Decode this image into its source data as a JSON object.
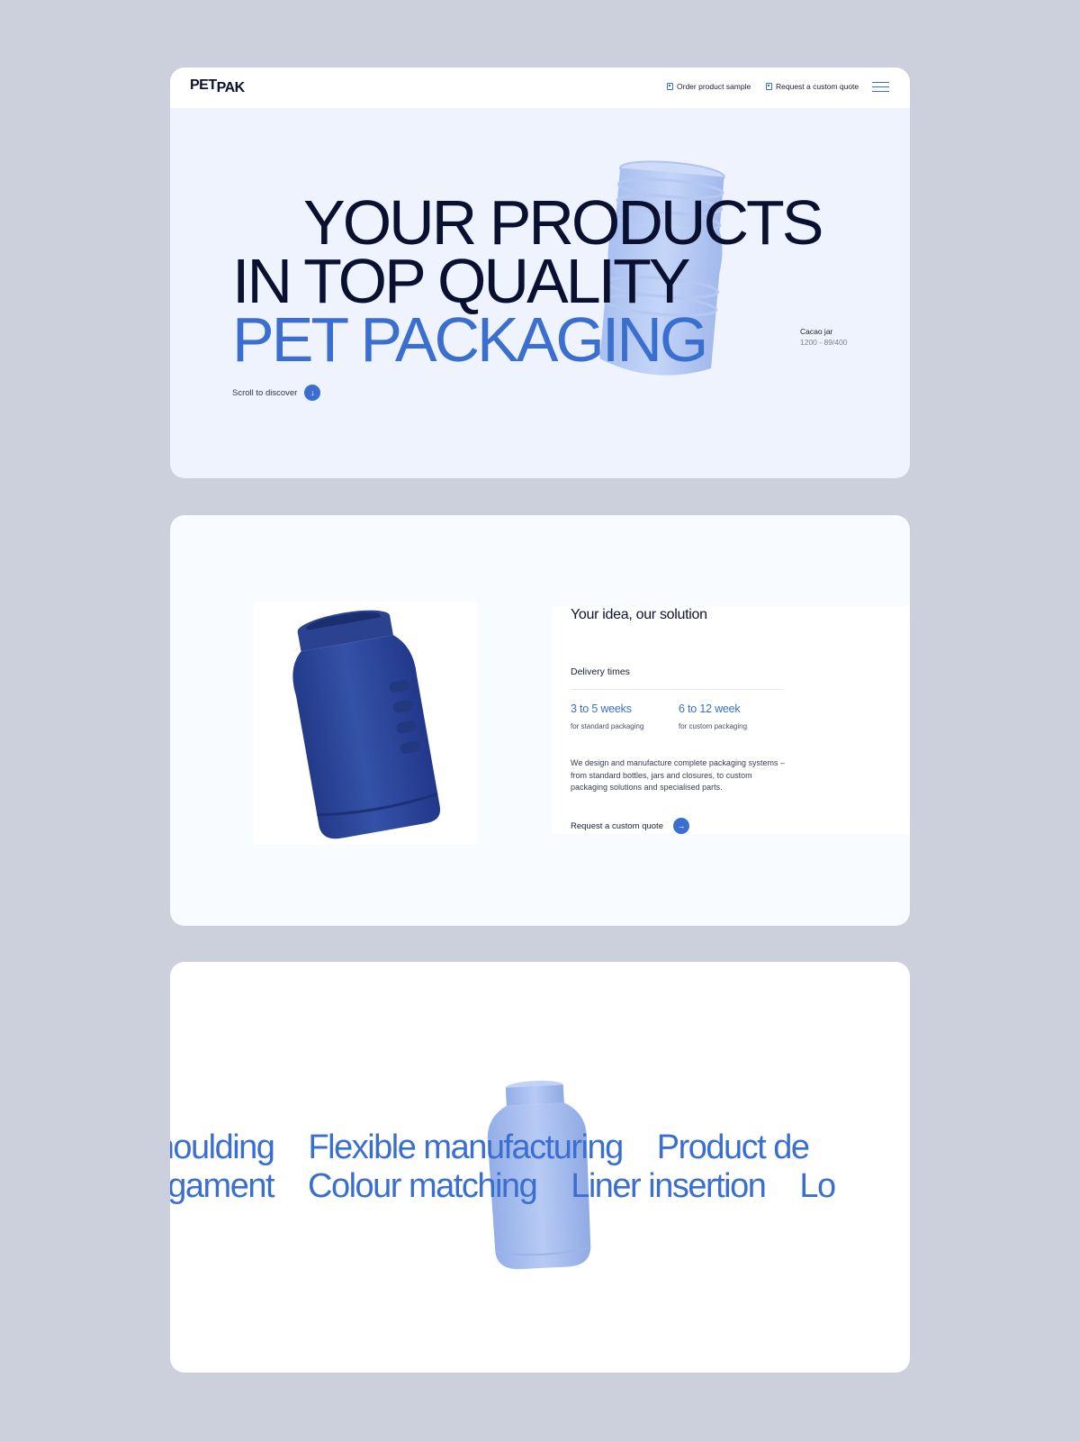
{
  "header": {
    "logo_pet": "PET",
    "logo_pak": "PAK",
    "order_sample_label": "Order product sample",
    "custom_quote_label": "Request a custom quote"
  },
  "hero": {
    "line1": "YOUR PRODUCTS",
    "line2": "IN TOP QUALITY",
    "line3": "PET PACKAGING",
    "scroll_label": "Scroll to discover",
    "product_name": "Cacao jar",
    "product_code": "1200 - 89/400"
  },
  "solution": {
    "title": "Your idea, our solution",
    "delivery_label": "Delivery times",
    "stats": [
      {
        "value": "3 to 5 weeks",
        "label": "for standard packaging"
      },
      {
        "value": "6 to 12 week",
        "label": "for custom packaging"
      }
    ],
    "description": "We design and manufacture complete packaging systems – from standard bottles, jars and closures, to custom packaging solutions and specialised parts.",
    "quote_label": "Request a custom quote"
  },
  "services": {
    "row1": [
      "m moulding",
      "Flexible manufacturing",
      "Product de"
    ],
    "row2": [
      "nagament",
      "Colour matching",
      "Liner insertion",
      "Lo"
    ]
  },
  "colors": {
    "page_bg": "#cbd0dc",
    "accent": "#3a6fd0",
    "ink": "#0a1130",
    "hero_bg": "#eef3fe",
    "jar_dark": "#2d4497"
  },
  "icons": [
    "sample-icon",
    "quote-icon",
    "menu-icon",
    "arrow-down-icon",
    "arrow-right-icon"
  ]
}
